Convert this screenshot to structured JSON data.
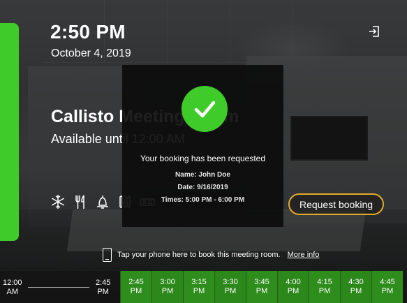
{
  "clock": {
    "time": "2:50 PM",
    "date": "October 4, 2019"
  },
  "room": {
    "name": "Callisto Meeting Room",
    "status": "Available until 12:00 AM"
  },
  "amenities": [
    "snowflake-icon",
    "utensils-icon",
    "bell-icon",
    "heater-icon",
    "projector-icon"
  ],
  "modal": {
    "title": "Your booking has been requested",
    "name": "Name: John Doe",
    "date": "Date: 9/16/2019",
    "times": "Times: 5:00 PM - 6:00 PM"
  },
  "actions": {
    "request_booking": "Request booking"
  },
  "nfc": {
    "text": "Tap your phone here to book this meeting room.",
    "more": "More info"
  },
  "timeline": {
    "start": [
      "12:00",
      "AM"
    ],
    "now": [
      "2:45",
      "PM"
    ],
    "slots": [
      [
        "2:45",
        "PM"
      ],
      [
        "3:00",
        "PM"
      ],
      [
        "3:15",
        "PM"
      ],
      [
        "3:30",
        "PM"
      ],
      [
        "3:45",
        "PM"
      ],
      [
        "4:00",
        "PM"
      ],
      [
        "4:15",
        "PM"
      ],
      [
        "4:30",
        "PM"
      ],
      [
        "4:45",
        "PM"
      ]
    ]
  },
  "colors": {
    "accent_green": "#3fcb29",
    "slot_green": "#2f8d1d",
    "button_border": "#e2a92c"
  }
}
